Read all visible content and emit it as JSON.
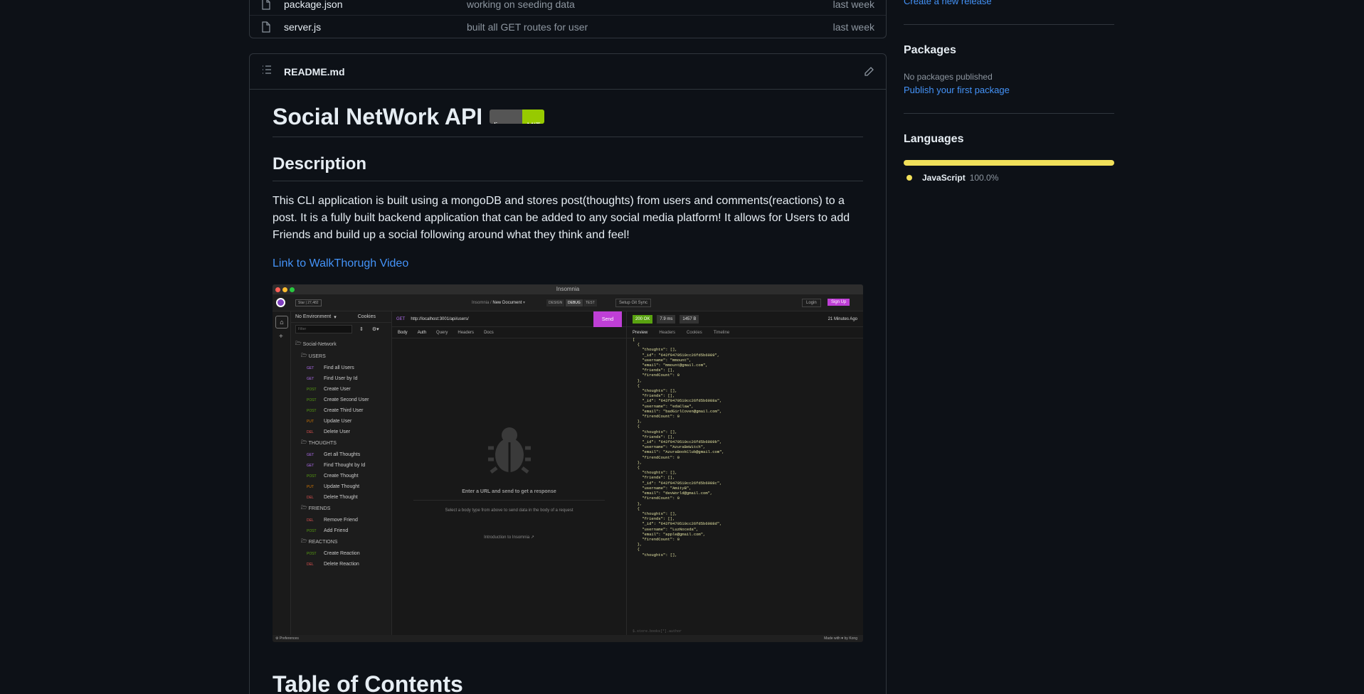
{
  "files": [
    {
      "name": "package.json",
      "message": "working on seeding data",
      "date": "last week"
    },
    {
      "name": "server.js",
      "message": "built all GET routes for user",
      "date": "last week"
    }
  ],
  "readme": {
    "filename": "README.md",
    "title": "Social NetWork API",
    "badge_left": "license",
    "badge_right": "MIT",
    "h2_description": "Description",
    "description": "This CLI application is built using a mongoDB and stores post(thoughts) from users and comments(reactions) to a post. It is a fully built backend application that can be added to any social media platform! It allows for Users to add Friends and build up a social following around what they think and feel!",
    "video_link": "Link to WalkThorugh Video",
    "toc_title": "Table of Contents"
  },
  "screenshot": {
    "window_title": "Insomnia",
    "star_label": "Star",
    "star_count": "27,482",
    "breadcrumb_app": "Insomnia",
    "breadcrumb_doc": "New Document",
    "tab_design": "DESIGN",
    "tab_debug": "DEBUG",
    "tab_test": "TEST",
    "git_sync": "Setup Git Sync",
    "login": "Login",
    "signup": "Sign Up",
    "env": "No Environment",
    "cookies": "Cookies",
    "filter": "Filter",
    "workspace": "Social-Network",
    "groups": {
      "users": "USERS",
      "thoughts": "THOUGHTS",
      "friends": "FRIENDS",
      "reactions": "REACTIONS"
    },
    "requests_users": [
      {
        "m": "GET",
        "name": "Find all Users"
      },
      {
        "m": "GET",
        "name": "Find User by Id"
      },
      {
        "m": "POST",
        "name": "Create User"
      },
      {
        "m": "POST",
        "name": "Create Second User"
      },
      {
        "m": "POST",
        "name": "Create Third User"
      },
      {
        "m": "PUT",
        "name": "Update User"
      },
      {
        "m": "DEL",
        "name": "Delete User"
      }
    ],
    "requests_thoughts": [
      {
        "m": "GET",
        "name": "Get all Thoughts"
      },
      {
        "m": "GET",
        "name": "Find Thought by Id"
      },
      {
        "m": "POST",
        "name": "Create Thought"
      },
      {
        "m": "PUT",
        "name": "Update Thought"
      },
      {
        "m": "DEL",
        "name": "Delete Thought"
      }
    ],
    "requests_friends": [
      {
        "m": "DEL",
        "name": "Remove Friend"
      },
      {
        "m": "POST",
        "name": "Add Friend"
      }
    ],
    "requests_reactions": [
      {
        "m": "POST",
        "name": "Create Reaction"
      },
      {
        "m": "DEL",
        "name": "Delete Reaction"
      }
    ],
    "method": "GET",
    "url": "http://localhost:3001/api/users/",
    "send": "Send",
    "tab_body": "Body",
    "tab_auth": "Auth",
    "tab_query": "Query",
    "tab_headers": "Headers",
    "tab_docs": "Docs",
    "empty_title": "Enter a URL and send to get a response",
    "empty_sub": "Select a body type from above to send data in the body of a request",
    "intro_link": "Introduction to Insomnia",
    "status": "200 OK",
    "time": "7.9 ms",
    "size": "1457 B",
    "ago": "21 Minutes Ago",
    "resp_preview": "Preview",
    "resp_headers": "Headers",
    "resp_cookies": "Cookies",
    "resp_timeline": "Timeline",
    "filter_hint": "$.store.books[*].author",
    "preferences": "Preferences",
    "made_with": "Made with ♥ by Kong",
    "code": "[\n  {\n    \"thoughts\": [],\n    \"_id\": \"642f9479510cc26fd5b6989\",\n    \"username\": \"mmount\",\n    \"email\": \"mmount@gmail.com\",\n    \"friends\": [],\n    \"firendCount\": 0\n  },\n  {\n    \"thoughts\": [],\n    \"friends\": [],\n    \"_id\": \"642f9479510cc26fd5b6988a\",\n    \"username\": \"edaClaw\",\n    \"email\": \"badGirlCoven@gmail.com\",\n    \"firendCount\": 0\n  },\n  {\n    \"thoughts\": [],\n    \"friends\": [],\n    \"_id\": \"642f9479510cc26fd5b6989b\",\n    \"username\": \"AzuraBeWitch\",\n    \"email\": \"AzuraBookClub@gmail.com\",\n    \"firendCount\": 0\n  },\n  {\n    \"thoughts\": [],\n    \"friends\": [],\n    \"_id\": \"642f9479510cc26fd5b6988c\",\n    \"username\": \"AmityB\",\n    \"email\": \"devWorld@gmail.com\",\n    \"firendCount\": 0\n  },\n  {\n    \"thoughts\": [],\n    \"friends\": [],\n    \"_id\": \"642f9479510cc26fd5b6988d\",\n    \"username\": \"LuzNoceda\",\n    \"email\": \"apple@gmail.com\",\n    \"firendCount\": 0\n  },\n  {\n    \"thoughts\": [],"
  },
  "sidebar": {
    "release_link": "Create a new release",
    "packages_title": "Packages",
    "packages_none": "No packages published",
    "packages_link": "Publish your first package",
    "languages_title": "Languages",
    "lang_name": "JavaScript",
    "lang_pct": "100.0%",
    "lang_color": "#f1e05a"
  }
}
